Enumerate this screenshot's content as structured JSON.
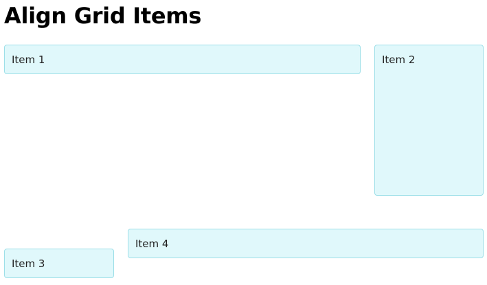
{
  "page": {
    "title": "Align Grid Items"
  },
  "grid": {
    "items": [
      {
        "label": "Item 1"
      },
      {
        "label": "Item 2"
      },
      {
        "label": "Item 3"
      },
      {
        "label": "Item 4"
      }
    ]
  },
  "colors": {
    "item_background": "#e0f8fb",
    "item_border": "#9ddfe8"
  }
}
